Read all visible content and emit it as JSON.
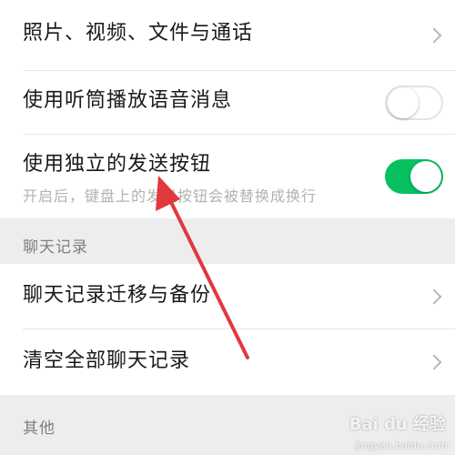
{
  "settings": {
    "photos_row": {
      "label": "照片、视频、文件与通话"
    },
    "earpiece_row": {
      "label": "使用听筒播放语音消息",
      "enabled": false
    },
    "send_button_row": {
      "label": "使用独立的发送按钮",
      "description": "开启后，键盘上的发送按钮会被替换成换行",
      "enabled": true
    },
    "chat_history_section": {
      "label": "聊天记录"
    },
    "migrate_row": {
      "label": "聊天记录迁移与备份"
    },
    "clear_row": {
      "label": "清空全部聊天记录"
    },
    "other_section": {
      "label": "其他"
    }
  },
  "watermark": {
    "brand": "Bai du 经验",
    "url": "jingyan.baidu.com"
  },
  "colors": {
    "toggle_on": "#07c160",
    "annotation_arrow": "#e0393e",
    "background": "#ededed"
  }
}
